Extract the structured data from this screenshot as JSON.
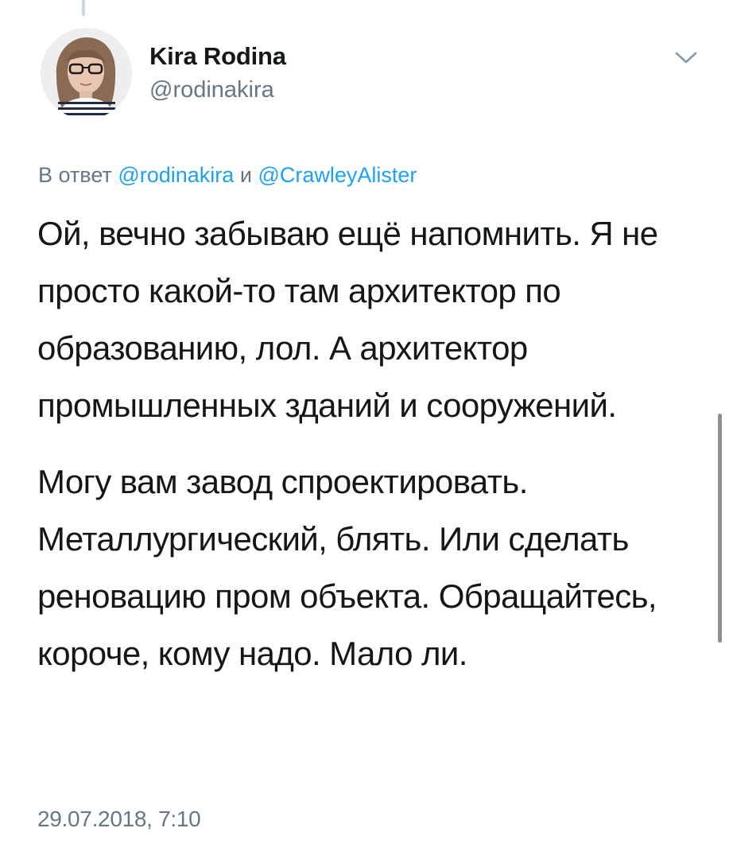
{
  "author": {
    "display_name": "Kira Rodina",
    "handle": "@rodinakira"
  },
  "reply": {
    "prefix": "В ответ",
    "mention_1": "@rodinakira",
    "conjunction": "и",
    "mention_2": "@CrawleyAlister"
  },
  "tweet": {
    "paragraph_1": "Ой, вечно забываю ещё напомнить. Я не просто какой-то там архитектор по образованию, лол. А архитектор промышленных зданий и сооружений.",
    "paragraph_2": "Могу вам завод спроектировать. Металлургический, блять. Или сделать реновацию пром объекта. Обращайтесь, короче, кому надо. Мало ли."
  },
  "timestamp": "29.07.2018, 7:10",
  "icons": {
    "menu": "chevron-down-icon",
    "avatar": "profile-photo"
  },
  "colors": {
    "text_primary": "#14171a",
    "text_secondary": "#657786",
    "link": "#1da1f2",
    "thread_line": "#ccd6dd"
  }
}
